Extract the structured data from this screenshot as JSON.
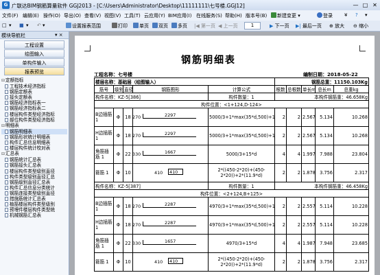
{
  "window": {
    "title": "广联达BIM钢筋算量软件 GGJ2013 - [C:\\Users\\Administrator\\Desktop\\11111111\\七号楼.GGJ12]",
    "min": "—",
    "max": "□",
    "close": "✕",
    "logo": "G"
  },
  "menubar": {
    "items": [
      "文件(F)",
      "编辑(E)",
      "操作(O)",
      "导出(O)",
      "查看(V)",
      "视图(V)",
      "工具(T)",
      "云应用(Y)",
      "BIM应用(I)",
      "在线服务(S)",
      "帮助(H)",
      "版本号(B)",
      "新建变更",
      "▾"
    ],
    "login": "登录",
    "right_icons": [
      "¥",
      "?",
      "▾"
    ]
  },
  "toolbar": {
    "left_icons": [
      "□",
      "▾",
      "▾",
      "▾"
    ],
    "items": [
      "设置报表范围",
      "打印",
      "单页",
      "双页",
      "多页",
      "第一页",
      "上一页",
      "1"
    ],
    "right_items": [
      "下一页",
      "最后一页",
      "放大",
      "缩小"
    ]
  },
  "sidepanel": {
    "title": "模块导航栏",
    "pin": "▾ ×",
    "nav_buttons": [
      "工程设置",
      "绘图输入",
      "单构件输入",
      "报表预览"
    ],
    "groups": [
      {
        "name": "定额指标",
        "items": [
          "工程技术经济指标",
          "钢筋定额表",
          "接头定额表",
          "钢筋经济指标表一",
          "钢筋经济指标表二",
          "楼层构件类型经济指标",
          "部位构件类型经济指标"
        ]
      },
      {
        "name": "明细表",
        "items": [
          "钢筋明细表",
          "钢筋形状统计明细表",
          "构件汇总信息明细表",
          "楼层构件统计校对表"
        ]
      },
      {
        "name": "汇总表",
        "items": [
          "钢筋统计汇总表",
          "钢筋接头汇总表",
          "楼层构件类型级别直径",
          "构件类型级别直径汇总",
          "钢筋级别直径汇总表",
          "构件汇总信息分类统计",
          "钢筋连接类型级别直径",
          "措施筋统计汇总表",
          "植筋楼层构件类型级别",
          "预埋件楼层构件类型统",
          "机械钢筋汇总表"
        ]
      }
    ]
  },
  "report": {
    "title": "钢筋明细表",
    "project_label": "工程名称：七号楼",
    "date_label": "编制日期：2018-05-22",
    "floor_label": "楼层名称：基础层（绘图输入）",
    "total_label": "钢筋总重：11150.103Kg",
    "columns": [
      "筋号",
      "级别",
      "直径",
      "钢筋图形",
      "计算公式",
      "根数",
      "总根数",
      "单长m",
      "总长m",
      "总重kg"
    ],
    "components": [
      {
        "name": "构件名称：KZ-5[386]",
        "count": "构件数量：1",
        "weight": "本构件钢筋重：46.658Kg",
        "position": "构件位置：<1+124,D-124>",
        "rows": [
          {
            "no": "B边插筋 1",
            "grade": "Φ",
            "dia": "18",
            "left": "270",
            "len": "2297",
            "formula": "5000/3+1*max(35*d,500)+15*d",
            "n": "2",
            "tn": "2",
            "unit": "2.567",
            "tlen": "5.134",
            "tw": "10.268"
          },
          {
            "no": "H边插筋 1",
            "grade": "Φ",
            "dia": "18",
            "left": "270",
            "len": "2297",
            "formula": "5000/3+1*max(35*d,500)+15*d",
            "n": "2",
            "tn": "2",
            "unit": "2.567",
            "tlen": "5.134",
            "tw": "10.268"
          },
          {
            "no": "角筋插筋 1",
            "grade": "Φ",
            "dia": "22",
            "left": "330",
            "len": "1667",
            "formula": "5000/3+15*d",
            "n": "4",
            "tn": "4",
            "unit": "1.997",
            "tlen": "7.988",
            "tw": "23.804"
          },
          {
            "no": "箍筋 1",
            "grade": "Φ",
            "dia": "10",
            "left": "410",
            "len": "410",
            "formula": "2*((450-2*20)+(450-2*20))+2*(11.9*d)",
            "n": "2",
            "tn": "2",
            "unit": "1.878",
            "tlen": "3.756",
            "tw": "2.317"
          }
        ]
      },
      {
        "name": "构件名称：KZ-5[387]",
        "count": "构件数量：1",
        "weight": "本构件钢筋重：46.458Kg",
        "position": "构件位置：<2+124,B+125>",
        "rows": [
          {
            "no": "B边插筋 1",
            "grade": "Φ",
            "dia": "18",
            "left": "270",
            "len": "2287",
            "formula": "4970/3+1*max(35*d,500)+15*d",
            "n": "2",
            "tn": "2",
            "unit": "2.557",
            "tlen": "5.114",
            "tw": "10.228"
          },
          {
            "no": "H边插筋 1",
            "grade": "Φ",
            "dia": "18",
            "left": "270",
            "len": "2287",
            "formula": "4970/3+1*max(35*d,500)+15*d",
            "n": "2",
            "tn": "2",
            "unit": "2.557",
            "tlen": "5.114",
            "tw": "10.228"
          },
          {
            "no": "角筋插筋 1",
            "grade": "Φ",
            "dia": "22",
            "left": "330",
            "len": "1657",
            "formula": "4970/3+15*d",
            "n": "4",
            "tn": "4",
            "unit": "1.987",
            "tlen": "7.948",
            "tw": "23.685"
          },
          {
            "no": "箍筋 1",
            "grade": "Φ",
            "dia": "10",
            "left": "410",
            "len": "410",
            "formula": "2*((450-2*20)+(450-2*20))+2*(11.9*d)",
            "n": "2",
            "tn": "2",
            "unit": "1.878",
            "tlen": "3.756",
            "tw": "2.317"
          }
        ]
      }
    ]
  }
}
